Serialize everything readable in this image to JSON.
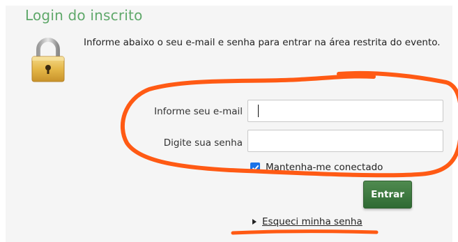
{
  "login": {
    "title": "Login do inscrito",
    "intro": "Informe abaixo o seu e-mail e senha para entrar na área restrita do evento.",
    "email_label": "Informe seu e-mail",
    "email_value": "",
    "password_label": "Digite sua senha",
    "password_value": "",
    "remember_label": "Mantenha-me conectado",
    "remember_checked": true,
    "submit_label": "Entrar",
    "forgot_label": "Esqueci minha senha"
  },
  "icons": {
    "lock": "padlock-icon",
    "checkbox": "checkmark-icon",
    "forgot_arrow": "triangle-right-icon"
  },
  "colors": {
    "title": "#5fa86a",
    "button": "#2f6a33",
    "annotation": "#ff5a14",
    "checkbox": "#1a73e8"
  }
}
